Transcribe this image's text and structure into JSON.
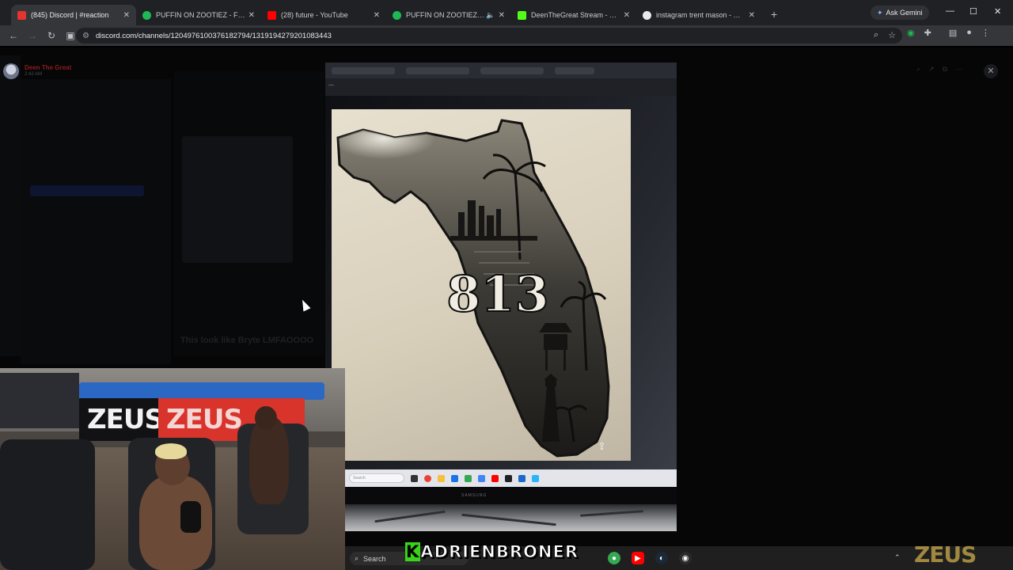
{
  "browser": {
    "tabs": [
      {
        "title": "(845) Discord | #reaction",
        "favicon_color": "#e3342f",
        "active": true
      },
      {
        "title": "PUFFIN ON ZOOTIEZ - Future",
        "favicon_color": "#1db954",
        "active": false
      },
      {
        "title": "(28) future - YouTube",
        "favicon_color": "#ff0000",
        "active": false
      },
      {
        "title": "PUFFIN ON ZOOTIEZ • Futu",
        "favicon_color": "#1db954",
        "active": false,
        "muted_audio": true
      },
      {
        "title": "DeenTheGreat Stream - Watch",
        "favicon_color": "#53fc18",
        "active": false
      },
      {
        "title": "instagram trent mason - Googl",
        "favicon_color": "#e8eaed",
        "active": false
      }
    ],
    "new_tab_label": "+",
    "gemini_label": "Ask Gemini",
    "url": "discord.com/channels/1204976100376182794/1319194279201083443"
  },
  "discord": {
    "username": "Deen The Great",
    "timestamp": "2:42 AM",
    "dim_message": "This look like Bryte LMFAOOOO"
  },
  "attachment": {
    "tattoo_text": "813",
    "monitor_brand": "SAMSUNG",
    "monitor_search": "Search"
  },
  "webcam": {
    "banner_black": "ZEUS",
    "banner_red": "ZEUS"
  },
  "taskbar": {
    "search_placeholder": "Search",
    "overlay_caption": "KADRIENBRONER",
    "watermark": "ZEUS"
  },
  "colors": {
    "tab_strip": "#202124",
    "toolbar": "#35363a",
    "banner_red": "#d9342b",
    "caption_k": "#39d31a"
  }
}
